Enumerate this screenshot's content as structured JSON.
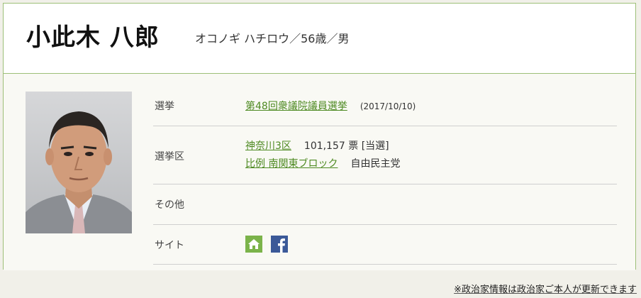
{
  "profile": {
    "name": "小此木 八郎",
    "subinfo": "オコノギ ハチロウ／56歳／男"
  },
  "rows": {
    "election": {
      "label": "選挙",
      "link": "第48回衆議院議員選挙",
      "date": "(2017/10/10)"
    },
    "district": {
      "label": "選挙区",
      "district_link": "神奈川3区",
      "votes": "101,157 票 [当選]",
      "block_link": "比例 南関東ブロック",
      "party": "自由民主党"
    },
    "other": {
      "label": "その他"
    },
    "site": {
      "label": "サイト",
      "icons": [
        "home-icon",
        "facebook-icon"
      ]
    }
  },
  "footer": {
    "note": "※政治家情報は政治家ご本人が更新できます"
  },
  "colors": {
    "accent_green": "#4e8a22",
    "border_green": "#9dbf78",
    "home_icon_bg": "#7bb34a",
    "facebook_bg": "#3b5998"
  }
}
